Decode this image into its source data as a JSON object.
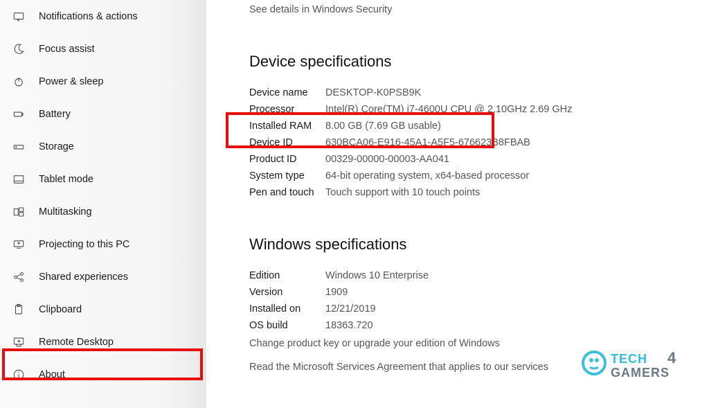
{
  "sidebar": {
    "items": [
      {
        "label": "Notifications & actions"
      },
      {
        "label": "Focus assist"
      },
      {
        "label": "Power & sleep"
      },
      {
        "label": "Battery"
      },
      {
        "label": "Storage"
      },
      {
        "label": "Tablet mode"
      },
      {
        "label": "Multitasking"
      },
      {
        "label": "Projecting to this PC"
      },
      {
        "label": "Shared experiences"
      },
      {
        "label": "Clipboard"
      },
      {
        "label": "Remote Desktop"
      },
      {
        "label": "About"
      }
    ]
  },
  "header": {
    "security_link": "See details in Windows Security"
  },
  "device_spec": {
    "title": "Device specifications",
    "rows": [
      {
        "label": "Device name",
        "value": "DESKTOP-K0PSB9K"
      },
      {
        "label": "Processor",
        "value": "Intel(R) Core(TM) i7-4600U CPU @ 2.10GHz 2.69 GHz"
      },
      {
        "label": "Installed RAM",
        "value": "8.00 GB (7.69 GB usable)"
      },
      {
        "label": "Device ID",
        "value": "630BCA06-E916-45A1-A5F5-676623B8FBAB"
      },
      {
        "label": "Product ID",
        "value": "00329-00000-00003-AA041"
      },
      {
        "label": "System type",
        "value": "64-bit operating system, x64-based processor"
      },
      {
        "label": "Pen and touch",
        "value": "Touch support with 10 touch points"
      }
    ]
  },
  "windows_spec": {
    "title": "Windows specifications",
    "rows": [
      {
        "label": "Edition",
        "value": "Windows 10 Enterprise"
      },
      {
        "label": "Version",
        "value": "1909"
      },
      {
        "label": "Installed on",
        "value": "12/21/2019"
      },
      {
        "label": "OS build",
        "value": "18363.720"
      }
    ],
    "change_key": "Change product key or upgrade your edition of Windows",
    "agreement": "Read the Microsoft Services Agreement that applies to our services"
  },
  "watermark": "TECH4 GAMERS"
}
